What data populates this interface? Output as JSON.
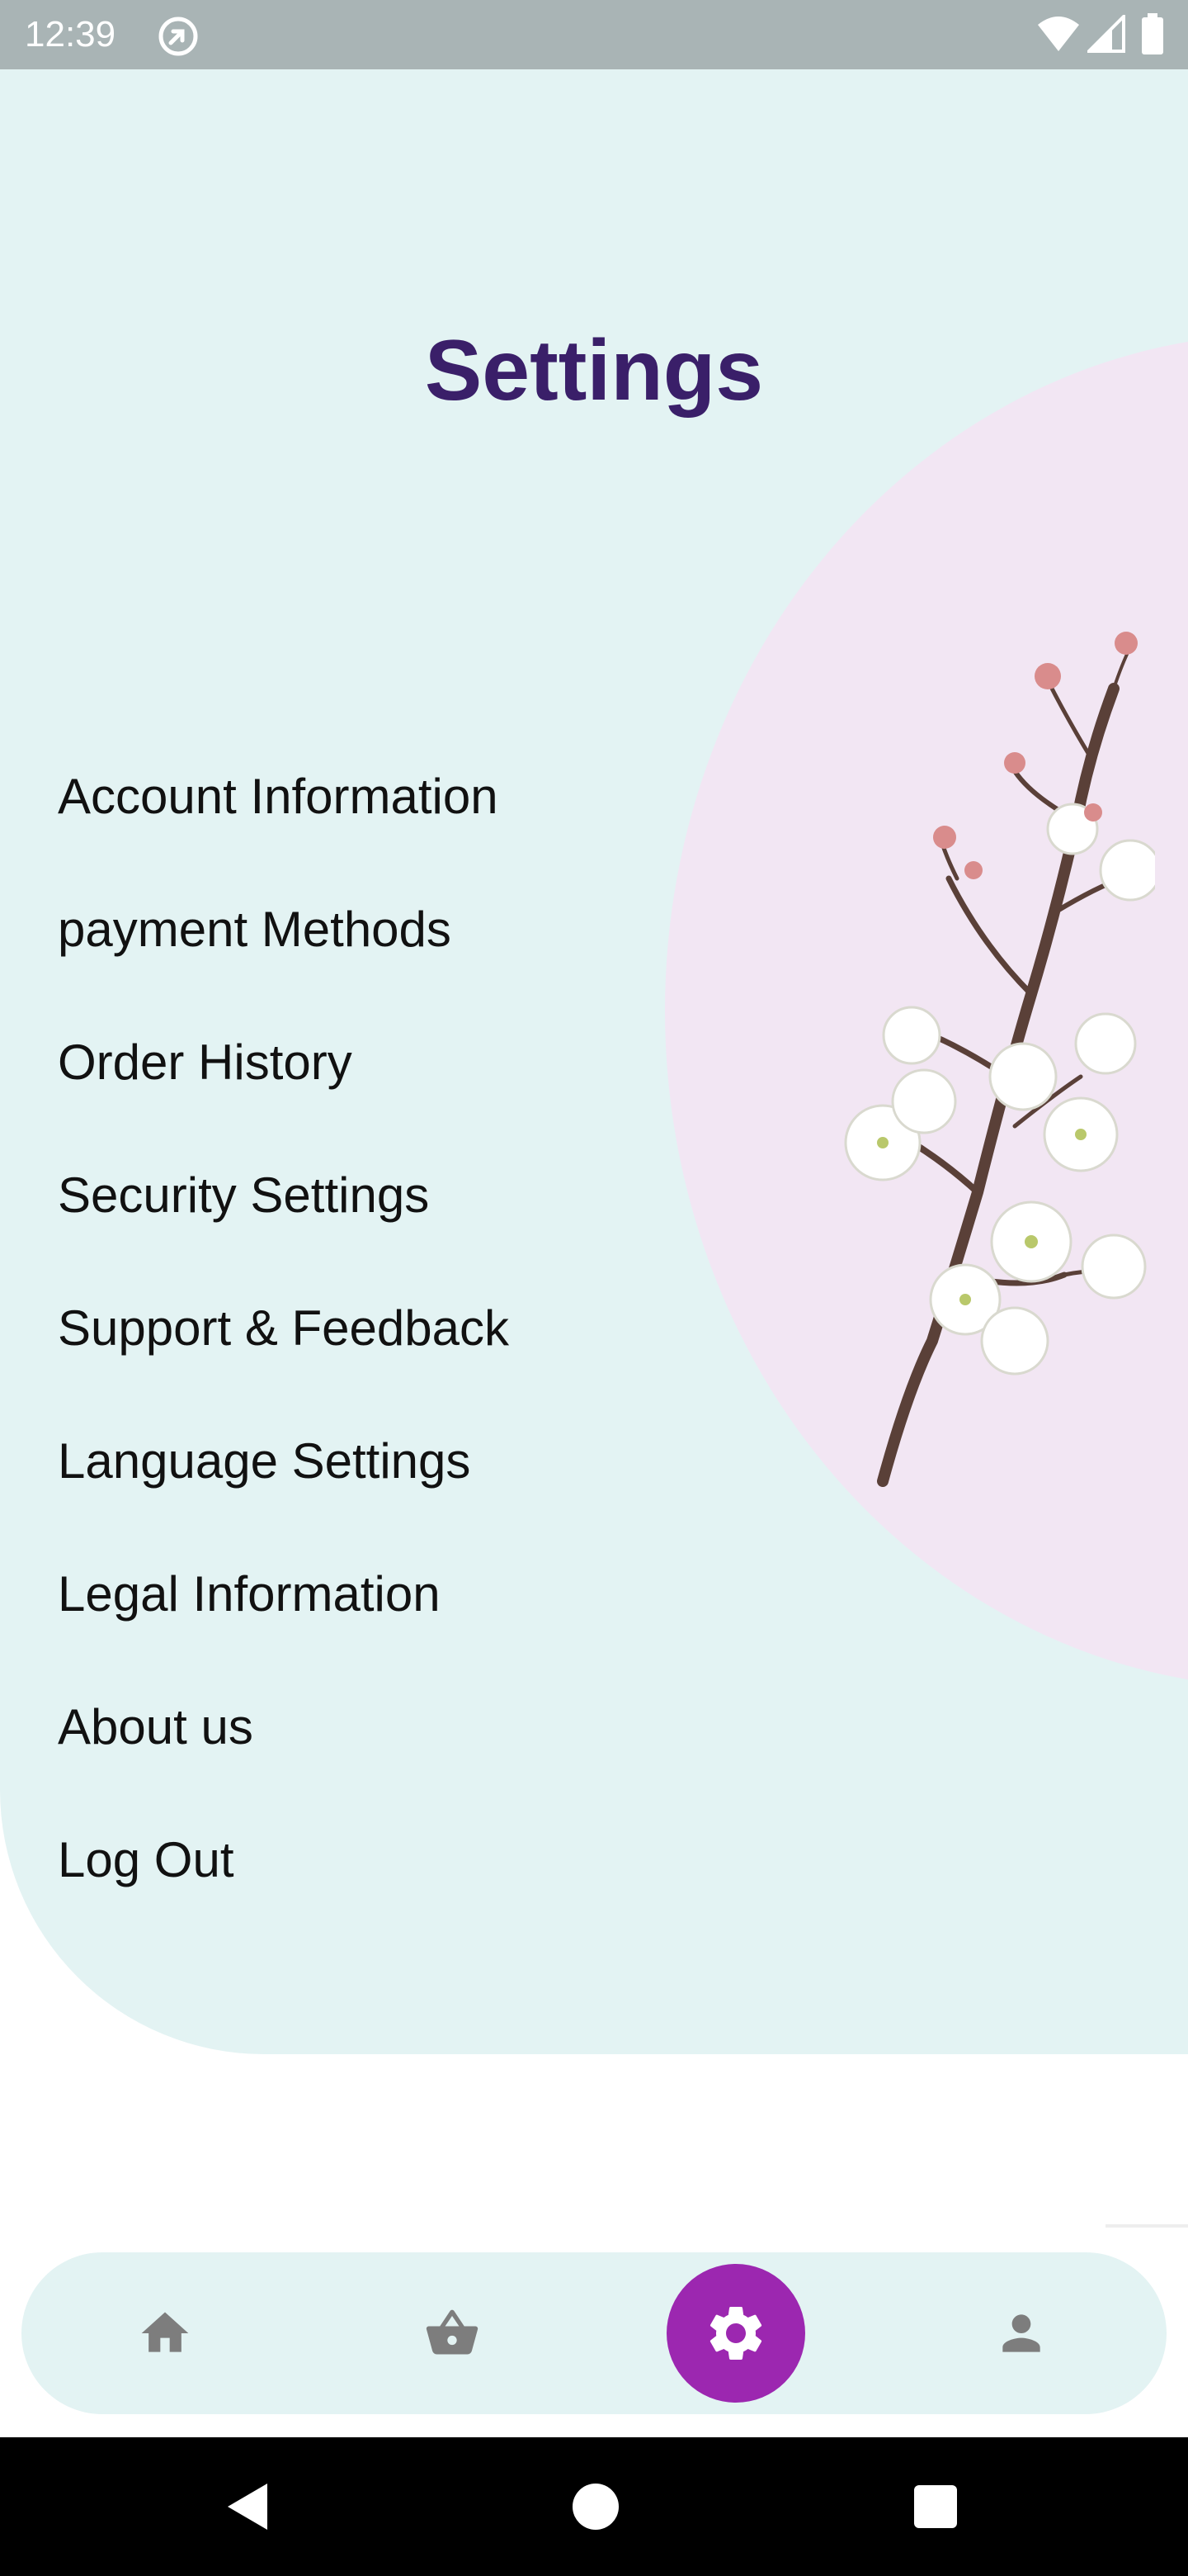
{
  "status_bar": {
    "time": "12:39",
    "icons": [
      "app-notification-icon",
      "wifi-icon",
      "signal-icon",
      "battery-icon"
    ]
  },
  "page": {
    "title": "Settings"
  },
  "menu": {
    "items": [
      {
        "label": "Account Information"
      },
      {
        "label": "payment Methods"
      },
      {
        "label": "Order History"
      },
      {
        "label": "Security Settings"
      },
      {
        "label": "Support & Feedback"
      },
      {
        "label": "Language Settings"
      },
      {
        "label": "Legal Information"
      },
      {
        "label": "About us"
      },
      {
        "label": "Log Out"
      }
    ]
  },
  "bottom_nav": {
    "items": [
      {
        "icon": "home-icon",
        "active": false
      },
      {
        "icon": "basket-icon",
        "active": false
      },
      {
        "icon": "gear-icon",
        "active": true
      },
      {
        "icon": "person-icon",
        "active": false
      }
    ]
  },
  "colors": {
    "title": "#3a1f69",
    "panel_background": "#e3f3f3",
    "decorative_circle": "#f2e6f3",
    "active_nav": "#9c27b0",
    "nav_icon": "#7d7d7d",
    "status_bar": "#a9b4b5"
  }
}
